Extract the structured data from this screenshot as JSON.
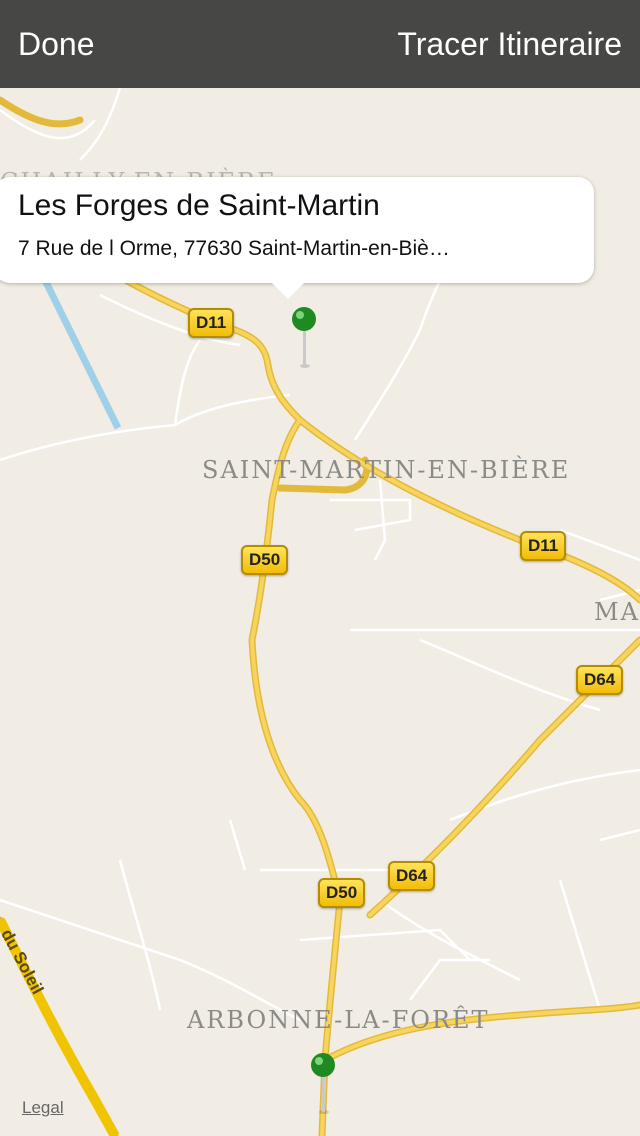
{
  "navbar": {
    "done_label": "Done",
    "route_label": "Tracer Itineraire"
  },
  "callout": {
    "title": "Les Forges de Saint-Martin",
    "subtitle": "7 Rue de l Orme, 77630 Saint-Martin-en-Biè…"
  },
  "map": {
    "places": [
      {
        "name": "SAINT-MARTIN-EN-BIÈRE"
      },
      {
        "name": "ARBONNE-LA-FORÊT"
      },
      {
        "name": "CHAILLY-EN-BIÈRE"
      },
      {
        "name": "MA"
      }
    ],
    "road_shields": [
      "D11",
      "D11",
      "D50",
      "D50",
      "D64",
      "D64"
    ],
    "road_names": [
      "du Soleil"
    ],
    "pin_color": "#1f8a22",
    "road_color": "#f6c842",
    "land_color": "#f1ede4"
  },
  "legal_label": "Legal"
}
